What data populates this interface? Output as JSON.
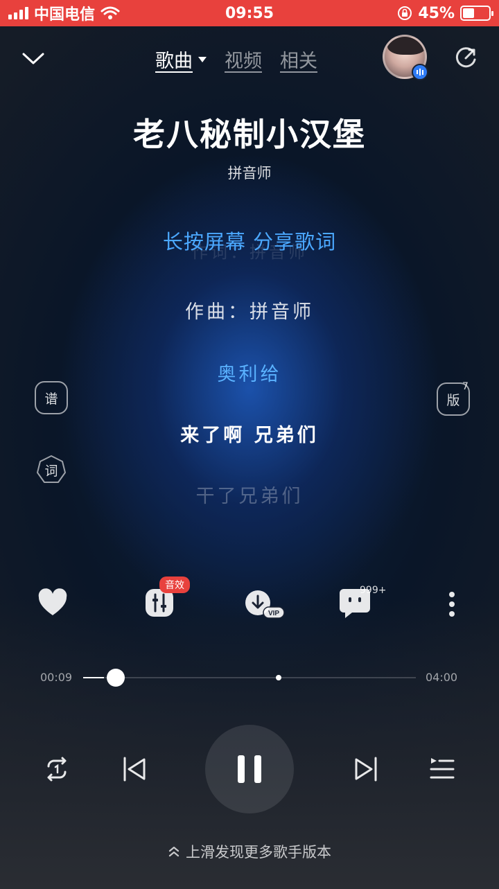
{
  "status_bar": {
    "carrier": "中国电信",
    "time": "09:55",
    "battery": "45%",
    "battery_level": 0.45
  },
  "header": {
    "tabs": [
      {
        "label": "歌曲",
        "active": true
      },
      {
        "label": "视频",
        "active": false
      },
      {
        "label": "相关",
        "active": false
      }
    ]
  },
  "song": {
    "title": "老八秘制小汉堡",
    "artist": "拼音师"
  },
  "lyrics": {
    "hint": "长按屏幕 分享歌词",
    "ghost": "作词：拼音师",
    "lines": [
      "作曲：拼音师",
      "奥利给",
      "来了啊 兄弟们",
      "干了兄弟们"
    ]
  },
  "side_buttons": {
    "sheet": "谱",
    "lyric": "词",
    "version": "版",
    "version_count": "7"
  },
  "actions": {
    "effect_badge": "音效",
    "download_tag": "VIP",
    "comment_count": "999+"
  },
  "progress": {
    "elapsed": "00:09",
    "total": "04:00",
    "fraction": 0.0375,
    "buffered_fraction": 0.58
  },
  "footer": {
    "swipe_hint": "上滑发现更多歌手版本"
  },
  "colors": {
    "status_bar": "#e8413d",
    "accent": "#4ba8ff",
    "badge": "#e8413d"
  }
}
